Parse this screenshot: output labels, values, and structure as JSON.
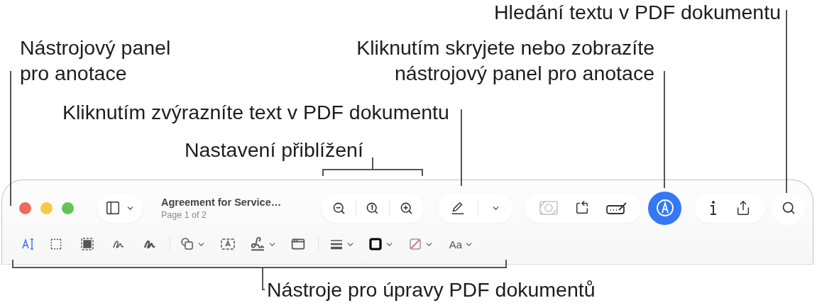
{
  "callouts": [
    {
      "lines": [
        "Hledání textu v PDF dokumentu"
      ]
    },
    {
      "lines": [
        "Nástrojový panel",
        "pro anotace"
      ]
    },
    {
      "lines": [
        "Kliknutím skryjete nebo zobrazíte",
        "nástrojový panel pro anotace"
      ]
    },
    {
      "lines": [
        "Kliknutím zvýrazníte text v PDF dokumentu"
      ]
    },
    {
      "lines": [
        "Nastavení přiblížení"
      ]
    },
    {
      "lines": [
        "Nástroje pro úpravy PDF dokumentů"
      ]
    }
  ],
  "document": {
    "title": "Agreement for Service…",
    "subtitle": "Page 1 of 2"
  },
  "markup_button": {
    "on": true
  },
  "image_button": {
    "disabled": true
  },
  "markup_tools": [
    {
      "kind": "text-select",
      "selected": true
    },
    {
      "kind": "rect-select",
      "selected": false
    },
    {
      "kind": "smart-select",
      "selected": false
    },
    {
      "kind": "sketch",
      "selected": false
    },
    {
      "kind": "draw",
      "selected": false
    },
    {
      "kind": "shapes",
      "selected": false
    },
    {
      "kind": "text-box",
      "selected": false
    },
    {
      "kind": "signature",
      "selected": false
    },
    {
      "kind": "note",
      "selected": false
    },
    {
      "kind": "line-style",
      "selected": false
    },
    {
      "kind": "border-color",
      "selected": false
    },
    {
      "kind": "fill-color",
      "selected": false
    },
    {
      "kind": "font",
      "selected": false,
      "label": "Aa"
    }
  ]
}
